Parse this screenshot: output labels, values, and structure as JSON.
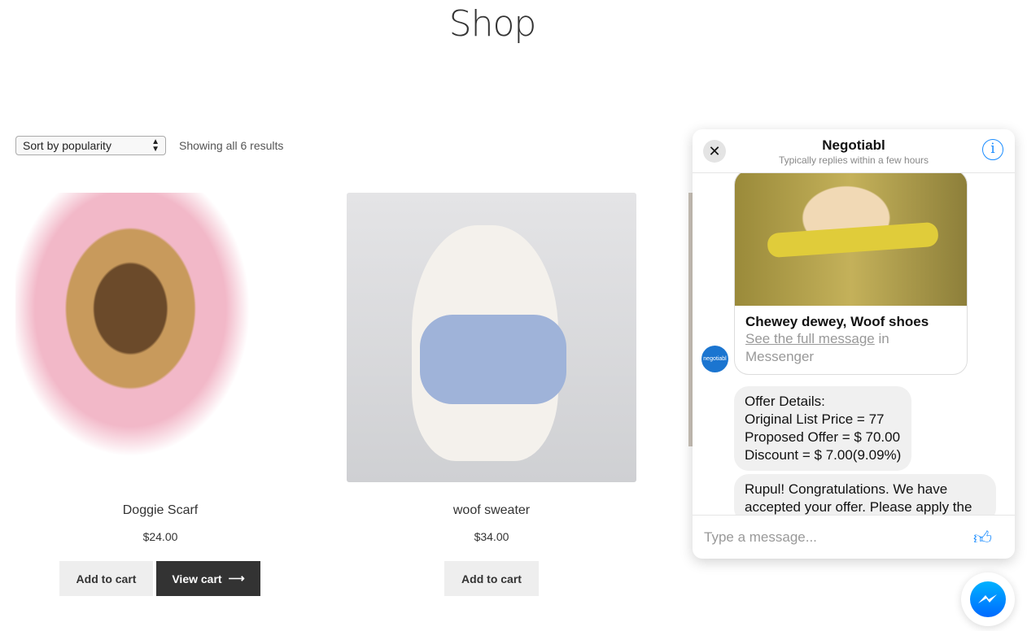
{
  "page": {
    "title": "Shop"
  },
  "toolbar": {
    "sort_value": "Sort by popularity",
    "result_count": "Showing all 6 results"
  },
  "products": [
    {
      "name": "Doggie Scarf",
      "price": "$24.00",
      "add_label": "Add to cart",
      "view_label": "View cart"
    },
    {
      "name": "woof sweater",
      "price": "$34.00",
      "add_label": "Add to cart"
    }
  ],
  "chat": {
    "name": "Negotiabl",
    "subtitle": "Typically replies within a few hours",
    "avatar_text": "negotiabl",
    "card": {
      "title": "Chewey dewey, Woof shoes",
      "link": "See the full message",
      "suffix": " in Messenger"
    },
    "messages": [
      [
        "Offer Details:",
        "Original List Price = 77",
        "Proposed Offer = $ 70.00",
        "Discount = $ 7.00(9.09%)"
      ],
      [
        "Rupul! Congratulations. We have",
        "accepted your offer. Please apply the"
      ]
    ],
    "input_placeholder": "Type a message...",
    "accent": "#1a8cff"
  }
}
